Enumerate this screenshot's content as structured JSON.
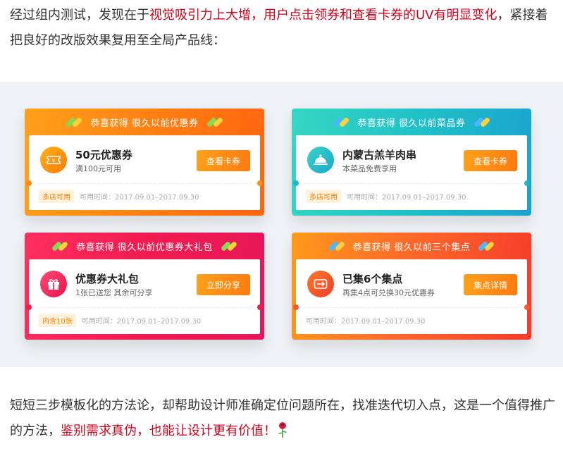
{
  "intro": {
    "part1": "经过组内测试，发现在于",
    "highlight": "视觉吸引力上大增，用户点击领券和查看卡券的UV有明显变化",
    "part2": "，紧接着把良好的改版效果复用至全局产品线："
  },
  "cards": [
    {
      "header": "恭喜获得 很久以前优惠券",
      "title": "50元优惠券",
      "subtitle": "满100元可用",
      "button": "查看卡券",
      "tag": "多店可用",
      "validity": "可用时间：2017.09.01–2017.09.30",
      "icon": "ticket-icon",
      "colors": [
        "#ffa11a",
        "#ff640f"
      ]
    },
    {
      "header": "恭喜获得 很久以前菜品券",
      "title": "内蒙古羔羊肉串",
      "subtitle": "本菜品免费享用",
      "button": "查看卡券",
      "tag": "多店可用",
      "validity": "可用时间：2017.09.01–2017.09.30",
      "icon": "food-cloche-icon",
      "colors": [
        "#36d7c3",
        "#1aa2cf"
      ]
    },
    {
      "header": "恭喜获得 很久以前优惠券大礼包",
      "title": "优惠券大礼包",
      "subtitle": "1张已送您  其余可分享",
      "button": "立即分享",
      "tag": "内含10张",
      "validity": "可用时间：2017.09.01–2017.09.30",
      "icon": "gift-icon",
      "colors": [
        "#ff2f5e",
        "#e8165a"
      ]
    },
    {
      "header": "恭喜获得 很久以前三个集点",
      "title": "已集6个集点",
      "subtitle": "再集4点可兑换30元优惠券",
      "button": "集点详情",
      "tag": "",
      "validity": "可用时间：2017.09.01–2017.09.30",
      "icon": "stamp-card-icon",
      "colors": [
        "#ff9a1a",
        "#f53a2a"
      ]
    }
  ],
  "outro": {
    "part1": "短短三步模板化的方法论，却帮助设计师准确定位问题所在，找准迭代切入点，这是一个值得推广的方法，",
    "highlight": "鉴别需求真伪，也能让设计更有价值！",
    "emoji": "rose-icon"
  },
  "colors": {
    "highlight": "#d0021b",
    "button": "#ff8a14",
    "background": "#eef1f5"
  }
}
